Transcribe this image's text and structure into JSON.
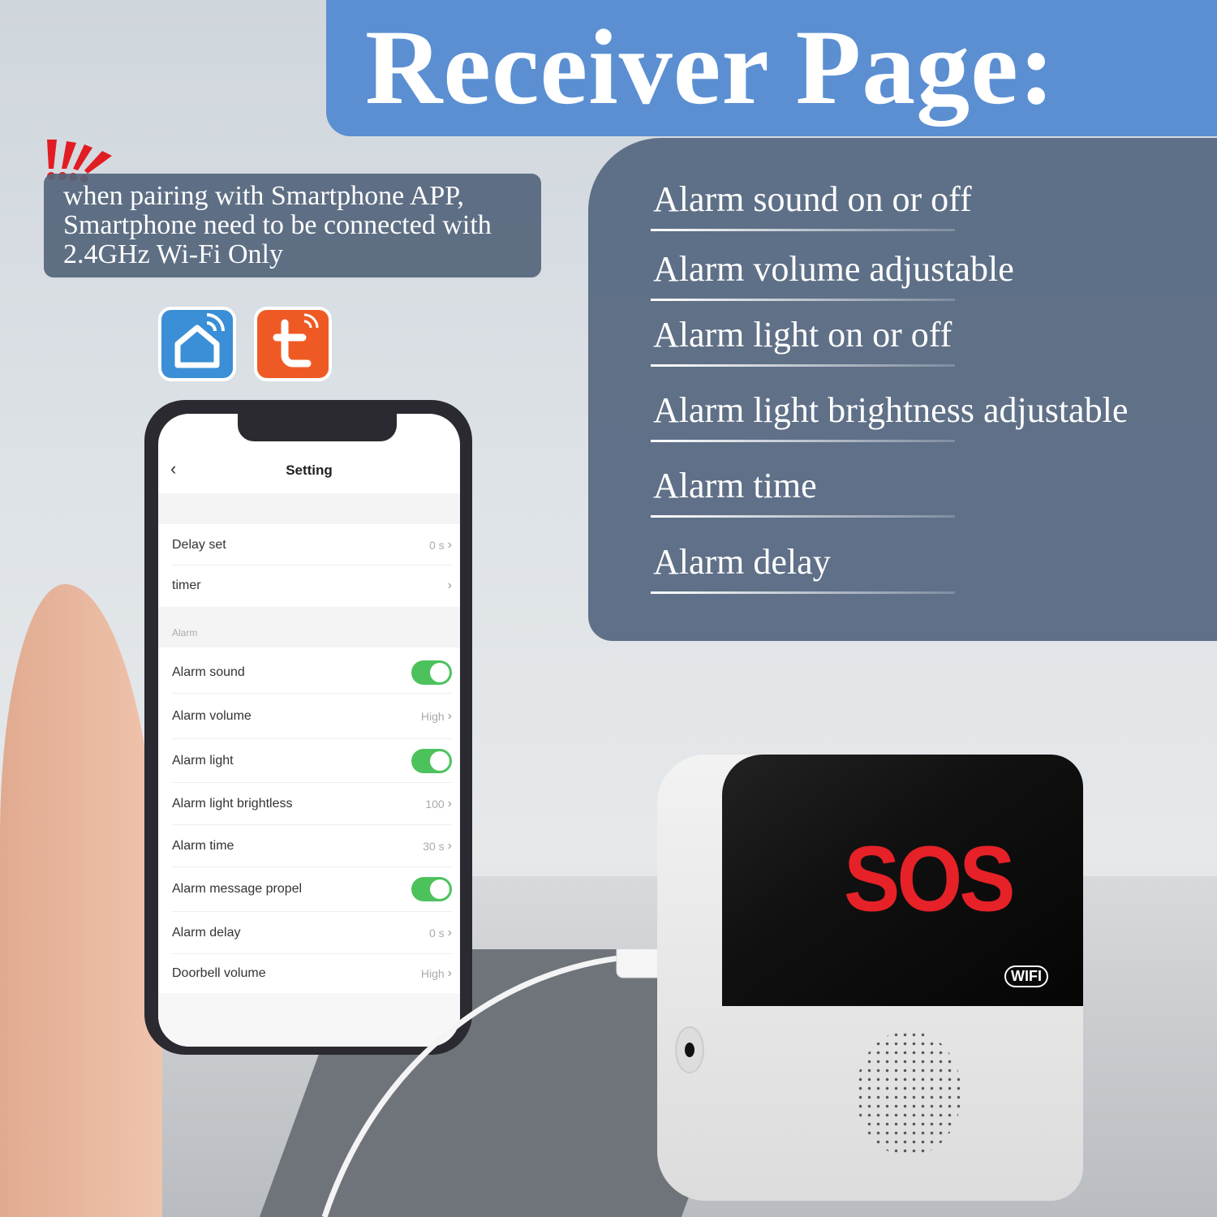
{
  "banner": {
    "title": "Receiver Page:"
  },
  "features": [
    "Alarm sound on or off",
    "Alarm volume adjustable",
    "Alarm light on or off",
    "Alarm light brightness adjustable",
    "Alarm time",
    "Alarm delay"
  ],
  "note": {
    "icon": "exclamation-marks-icon",
    "text": "when pairing with Smartphone APP, Smartphone need to be connected with 2.4GHz Wi-Fi Only"
  },
  "apps": [
    {
      "icon": "smart-home-app-icon",
      "color": "#3a8fd6"
    },
    {
      "icon": "tuya-app-icon",
      "color": "#ef5a24"
    }
  ],
  "phone": {
    "title": "Setting",
    "back_icon": "chevron-left-icon",
    "section": "Alarm",
    "rows": [
      {
        "label": "Delay set",
        "value": "0 s"
      },
      {
        "label": "timer",
        "value": ""
      },
      {
        "label": "Alarm sound",
        "toggle": true
      },
      {
        "label": "Alarm volume",
        "value": "High"
      },
      {
        "label": "Alarm light",
        "toggle": true
      },
      {
        "label": "Alarm light brightless",
        "value": "100"
      },
      {
        "label": "Alarm time",
        "value": "30 s"
      },
      {
        "label": "Alarm message propel",
        "toggle": true
      },
      {
        "label": "Alarm delay",
        "value": "0 s"
      },
      {
        "label": "Doorbell volume",
        "value": "High"
      }
    ],
    "toggle_color": "#4cc25d"
  },
  "device": {
    "display": "SOS",
    "badge": "WIFI",
    "display_color": "#e62128"
  }
}
